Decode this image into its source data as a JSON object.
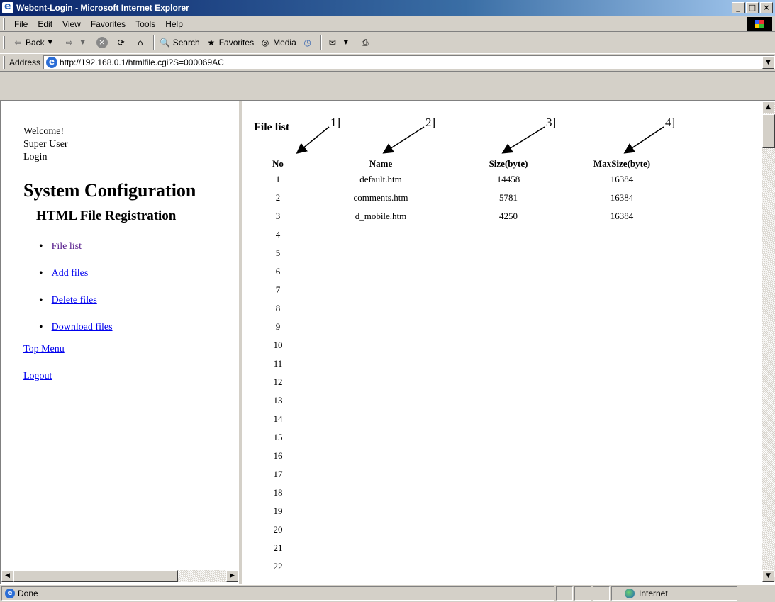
{
  "window": {
    "title": "Webcnt-Login - Microsoft Internet Explorer",
    "controls": [
      "_",
      "□",
      "×"
    ]
  },
  "menu": [
    "File",
    "Edit",
    "View",
    "Favorites",
    "Tools",
    "Help"
  ],
  "toolbar": {
    "back": "Back",
    "search": "Search",
    "favorites": "Favorites",
    "media": "Media"
  },
  "address": {
    "label": "Address",
    "url": "http://192.168.0.1/htmlfile.cgi?S=000069AC"
  },
  "sidebar": {
    "welcome": "Welcome!",
    "user": "Super User",
    "login": "Login",
    "heading": "System Configuration",
    "subheading": "HTML File Registration",
    "items": [
      {
        "label": "File list"
      },
      {
        "label": "Add files"
      },
      {
        "label": "Delete files"
      },
      {
        "label": "Download files"
      }
    ],
    "top_menu": "Top Menu",
    "logout": "Logout"
  },
  "main": {
    "title": "File list",
    "annotations": [
      "1]",
      "2]",
      "3]",
      "4]"
    ],
    "columns": [
      "No",
      "Name",
      "Size(byte)",
      "MaxSize(byte)"
    ],
    "rows": [
      {
        "no": "1",
        "name": "default.htm",
        "size": "14458",
        "max": "16384"
      },
      {
        "no": "2",
        "name": "comments.htm",
        "size": "5781",
        "max": "16384"
      },
      {
        "no": "3",
        "name": "d_mobile.htm",
        "size": "4250",
        "max": "16384"
      },
      {
        "no": "4",
        "name": "",
        "size": "",
        "max": ""
      },
      {
        "no": "5",
        "name": "",
        "size": "",
        "max": ""
      },
      {
        "no": "6",
        "name": "",
        "size": "",
        "max": ""
      },
      {
        "no": "7",
        "name": "",
        "size": "",
        "max": ""
      },
      {
        "no": "8",
        "name": "",
        "size": "",
        "max": ""
      },
      {
        "no": "9",
        "name": "",
        "size": "",
        "max": ""
      },
      {
        "no": "10",
        "name": "",
        "size": "",
        "max": ""
      },
      {
        "no": "11",
        "name": "",
        "size": "",
        "max": ""
      },
      {
        "no": "12",
        "name": "",
        "size": "",
        "max": ""
      },
      {
        "no": "13",
        "name": "",
        "size": "",
        "max": ""
      },
      {
        "no": "14",
        "name": "",
        "size": "",
        "max": ""
      },
      {
        "no": "15",
        "name": "",
        "size": "",
        "max": ""
      },
      {
        "no": "16",
        "name": "",
        "size": "",
        "max": ""
      },
      {
        "no": "17",
        "name": "",
        "size": "",
        "max": ""
      },
      {
        "no": "18",
        "name": "",
        "size": "",
        "max": ""
      },
      {
        "no": "19",
        "name": "",
        "size": "",
        "max": ""
      },
      {
        "no": "20",
        "name": "",
        "size": "",
        "max": ""
      },
      {
        "no": "21",
        "name": "",
        "size": "",
        "max": ""
      },
      {
        "no": "22",
        "name": "",
        "size": "",
        "max": ""
      }
    ]
  },
  "status": {
    "text": "Done",
    "zone": "Internet"
  }
}
